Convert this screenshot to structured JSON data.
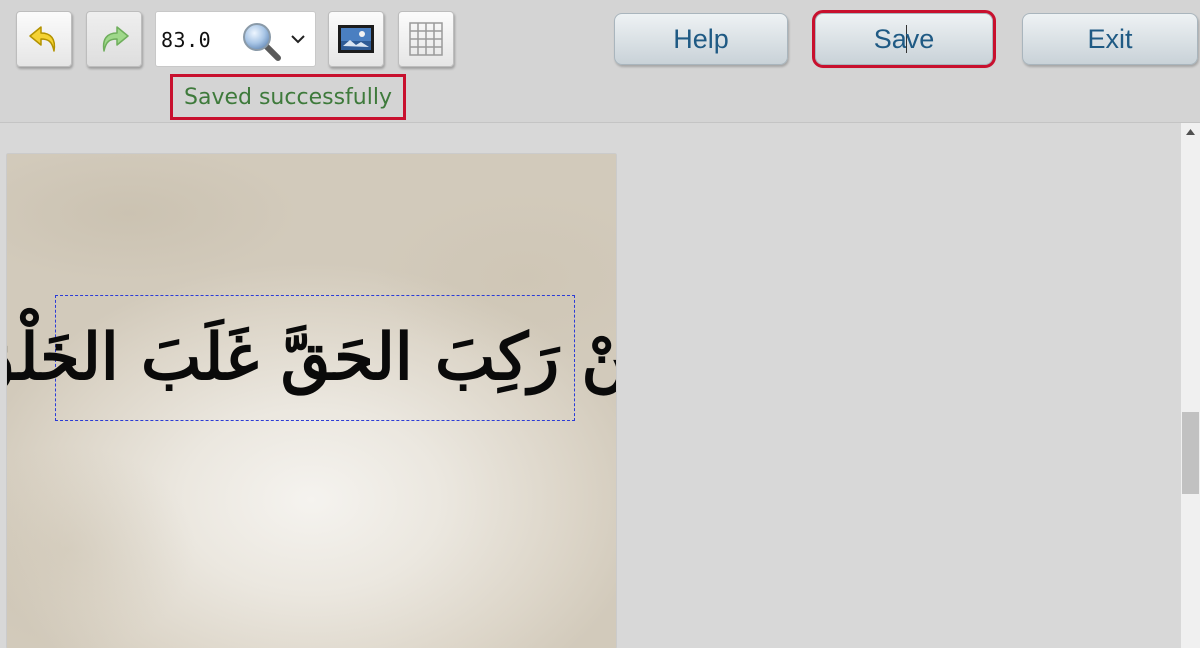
{
  "toolbar": {
    "zoom_value": "83.0",
    "status_message": "Saved successfully",
    "buttons": {
      "help_label": "Help",
      "save_label_before_caret": "Sa",
      "save_label_after_caret": "ve",
      "exit_label": "Exit"
    },
    "icons": {
      "undo": "undo-arrow-icon",
      "redo": "redo-arrow-icon",
      "zoom": "magnifier-icon",
      "zoom_dropdown": "chevron-down-icon",
      "background": "landscape-image-icon",
      "grid": "grid-icon"
    }
  },
  "canvas": {
    "calligraphy_text": "مَنْ رَكِبَ الحَقَّ غَلَبَ الخَلْقَ"
  },
  "colors": {
    "status_text": "#3e7a3b",
    "highlight_border": "#c8102e",
    "button_text": "#1f5a84",
    "selection_dash": "#2b3bd6"
  }
}
